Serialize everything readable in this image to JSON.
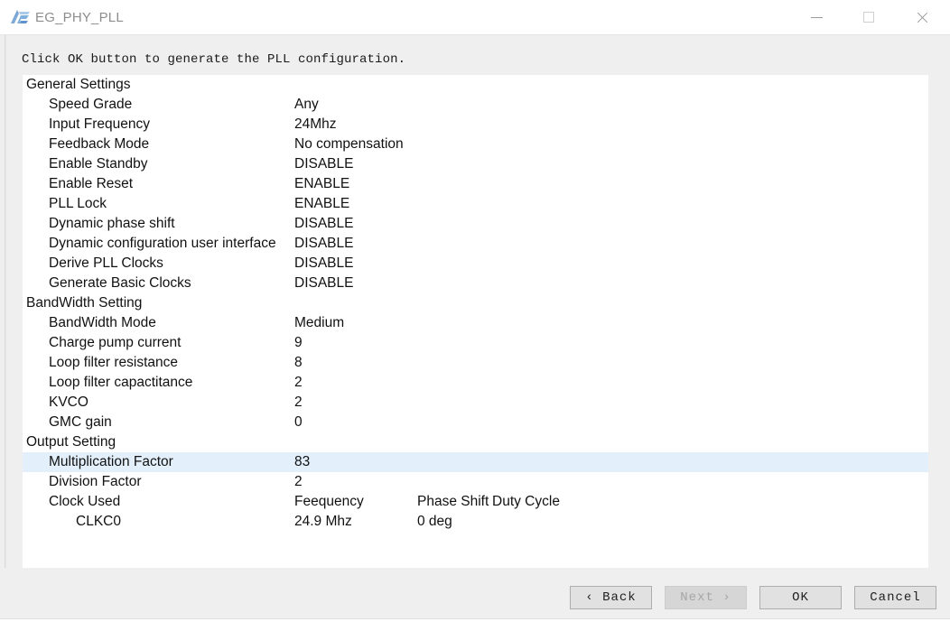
{
  "window": {
    "title": "EG_PHY_PLL",
    "logo_icon": "anlogic-logo-icon",
    "controls": {
      "minimize": "minimize-icon",
      "maximize": "maximize-icon",
      "close": "close-icon"
    }
  },
  "instruction": "Click OK button to generate the PLL configuration.",
  "colors": {
    "highlight_row": "#e3f0fc",
    "title_text": "#8d8d8d",
    "panel_bg": "#ffffff",
    "window_bg": "#efefef"
  },
  "list": {
    "columns": {
      "clock_used": "Clock Used",
      "frequency": "Feequency",
      "phase_shift": "Phase Shift",
      "duty_cycle": "Duty Cycle"
    },
    "rows": [
      {
        "label": "General Settings",
        "value": "",
        "indent": 0,
        "type": "section",
        "highlight": false
      },
      {
        "label": "Speed Grade",
        "value": "Any",
        "indent": 1,
        "type": "item",
        "highlight": false
      },
      {
        "label": "Input Frequency",
        "value": "24Mhz",
        "indent": 1,
        "type": "item",
        "highlight": false
      },
      {
        "label": "Feedback Mode",
        "value": "No compensation",
        "indent": 1,
        "type": "item",
        "highlight": false
      },
      {
        "label": "Enable Standby",
        "value": "DISABLE",
        "indent": 1,
        "type": "item",
        "highlight": false
      },
      {
        "label": "Enable Reset",
        "value": "ENABLE",
        "indent": 1,
        "type": "item",
        "highlight": false
      },
      {
        "label": "PLL Lock",
        "value": "ENABLE",
        "indent": 1,
        "type": "item",
        "highlight": false
      },
      {
        "label": "Dynamic phase shift",
        "value": "DISABLE",
        "indent": 1,
        "type": "item",
        "highlight": false
      },
      {
        "label": "Dynamic configuration user interface",
        "value": "DISABLE",
        "indent": 1,
        "type": "item",
        "highlight": false
      },
      {
        "label": "Derive PLL Clocks",
        "value": "DISABLE",
        "indent": 1,
        "type": "item",
        "highlight": false
      },
      {
        "label": "Generate Basic Clocks",
        "value": "DISABLE",
        "indent": 1,
        "type": "item",
        "highlight": false
      },
      {
        "label": "BandWidth Setting",
        "value": "",
        "indent": 0,
        "type": "section",
        "highlight": false
      },
      {
        "label": "BandWidth Mode",
        "value": "Medium",
        "indent": 1,
        "type": "item",
        "highlight": false
      },
      {
        "label": "Charge pump current",
        "value": "9",
        "indent": 1,
        "type": "item",
        "highlight": false
      },
      {
        "label": "Loop filter resistance",
        "value": "8",
        "indent": 1,
        "type": "item",
        "highlight": false
      },
      {
        "label": "Loop filter capactitance",
        "value": "2",
        "indent": 1,
        "type": "item",
        "highlight": false
      },
      {
        "label": "KVCO",
        "value": "2",
        "indent": 1,
        "type": "item",
        "highlight": false
      },
      {
        "label": "GMC gain",
        "value": "0",
        "indent": 1,
        "type": "item",
        "highlight": false
      },
      {
        "label": "Output Setting",
        "value": "",
        "indent": 0,
        "type": "section",
        "highlight": false
      },
      {
        "label": "Multiplication Factor",
        "value": "83",
        "indent": 1,
        "type": "item",
        "highlight": true
      },
      {
        "label": "Division Factor",
        "value": "2",
        "indent": 1,
        "type": "item",
        "highlight": false
      },
      {
        "label": "Clock Used",
        "value": "Feequency",
        "col3": "Phase Shift",
        "col4": "Duty Cycle",
        "indent": 1,
        "type": "header",
        "highlight": false
      },
      {
        "label": "CLKC0",
        "value": "24.9 Mhz",
        "col3": "0 deg",
        "indent": 2,
        "type": "item",
        "highlight": false
      }
    ]
  },
  "footer": {
    "buttons": [
      {
        "label": "‹ Back",
        "name": "back-button",
        "disabled": false
      },
      {
        "label": "Next ›",
        "name": "next-button",
        "disabled": true
      },
      {
        "label": "OK",
        "name": "ok-button",
        "disabled": false
      },
      {
        "label": "Cancel",
        "name": "cancel-button",
        "disabled": false
      }
    ]
  }
}
